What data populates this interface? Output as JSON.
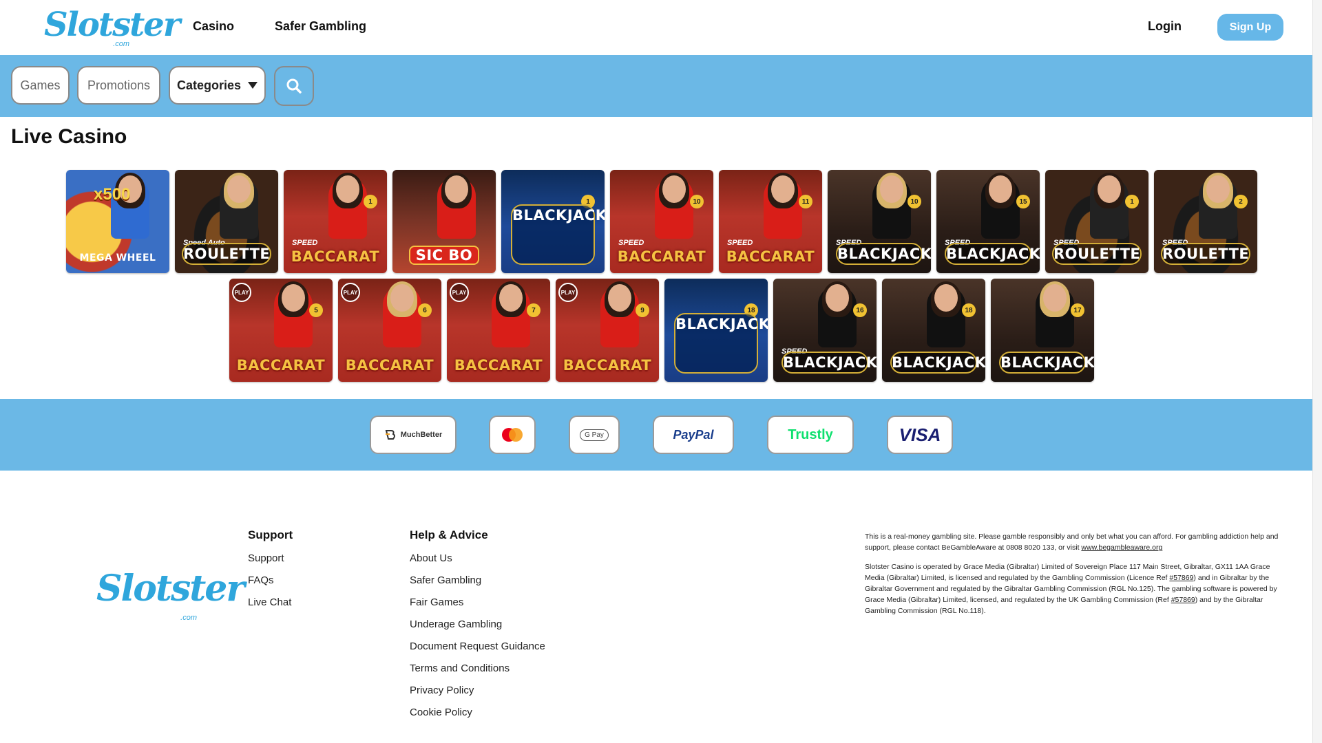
{
  "header": {
    "logo_text": "Slotster",
    "logo_sub": ".com",
    "nav": [
      "Casino",
      "Safer Gambling"
    ],
    "login": "Login",
    "signup": "Sign Up"
  },
  "filters": {
    "games": "Games",
    "promotions": "Promotions",
    "categories": "Categories"
  },
  "section_title": "Live Casino",
  "games_row1": [
    {
      "title": "MEGA WHEEL",
      "sub": "x500",
      "kind": "mega"
    },
    {
      "title": "ROULETTE",
      "sub": "Speed Auto",
      "kind": "roulette"
    },
    {
      "title": "BACCARAT",
      "sub": "SPEED",
      "badge": "1",
      "kind": "baccarat"
    },
    {
      "title": "SIC BO",
      "kind": "sicbo"
    },
    {
      "title": "BLACKJACK",
      "badge": "1",
      "kind": "bjx"
    },
    {
      "title": "BACCARAT",
      "sub": "SPEED",
      "badge": "10",
      "kind": "baccarat"
    },
    {
      "title": "BACCARAT",
      "sub": "SPEED",
      "badge": "11",
      "kind": "baccarat"
    },
    {
      "title": "BLACKJACK",
      "sub": "SPEED",
      "badge": "10",
      "kind": "bj"
    },
    {
      "title": "BLACKJACK",
      "sub": "SPEED",
      "badge": "15",
      "kind": "bj"
    },
    {
      "title": "ROULETTE",
      "sub": "SPEED",
      "badge": "1",
      "kind": "roulette"
    },
    {
      "title": "ROULETTE",
      "sub": "SPEED",
      "badge": "2",
      "kind": "roulette"
    }
  ],
  "games_row2": [
    {
      "title": "BACCARAT",
      "badge": "5",
      "kind": "baccarat",
      "play": "PLAY"
    },
    {
      "title": "BACCARAT",
      "badge": "6",
      "kind": "baccarat",
      "play": "PLAY"
    },
    {
      "title": "BACCARAT",
      "badge": "7",
      "kind": "baccarat",
      "play": "PLAY"
    },
    {
      "title": "BACCARAT",
      "badge": "9",
      "kind": "baccarat",
      "play": "PLAY"
    },
    {
      "title": "BLACKJACK",
      "badge": "18",
      "kind": "bjx"
    },
    {
      "title": "BLACKJACK",
      "sub": "SPEED",
      "badge": "16",
      "kind": "bj"
    },
    {
      "title": "BLACKJACK",
      "badge": "18",
      "kind": "bj"
    },
    {
      "title": "BLACKJACK",
      "badge": "17",
      "kind": "bj"
    }
  ],
  "payments": [
    "MuchBetter",
    "Mastercard",
    "G Pay",
    "PayPal",
    "Trustly",
    "VISA"
  ],
  "footer": {
    "support_head": "Support",
    "support_links": [
      "Support",
      "FAQs",
      "Live Chat"
    ],
    "help_head": "Help & Advice",
    "help_links": [
      "About Us",
      "Safer Gambling",
      "Fair Games",
      "Underage Gambling",
      "Document Request Guidance",
      "Terms and Conditions",
      "Privacy Policy",
      "Cookie Policy"
    ],
    "legal_p1": "This is a real-money gambling site. Please gamble responsibly and only bet what you can afford. For gambling addiction help and support, please contact BeGambleAware at 0808 8020 133, or visit",
    "legal_link": "www.begambleaware.org",
    "legal_p2a": "Slotster Casino is operated by Grace Media (Gibraltar) Limited of Sovereign Place 117 Main Street, Gibraltar, GX11 1AA Grace Media (Gibraltar) Limited, is licensed and regulated by the Gambling Commission (Licence Ref",
    "licence_ref": "#57869",
    "legal_p2b": ") and in Gibraltar by the Gibraltar Government and regulated by the Gibraltar Gambling Commission (RGL No.125). The gambling software is powered by Grace Media (Gibraltar) Limited, licensed, and regulated by the UK Gambling Commission (Ref",
    "legal_p2c": ") and by the Gibraltar Gambling Commission (RGL No.118)."
  },
  "colors": {
    "brand": "#2fa6dc",
    "band": "#6bb8e6",
    "signup": "#66b7e8"
  }
}
